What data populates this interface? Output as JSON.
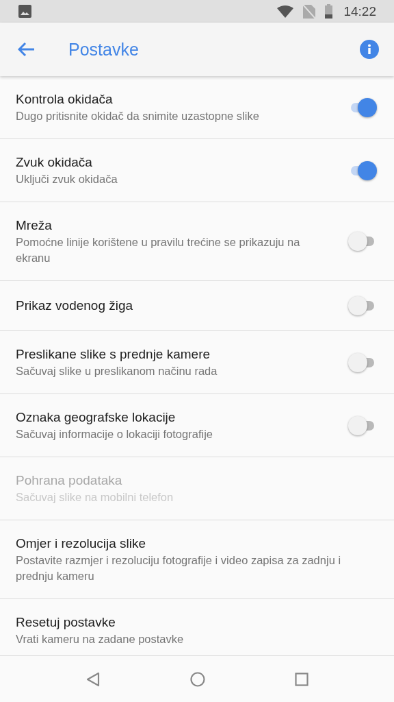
{
  "status_bar": {
    "time": "14:22"
  },
  "app_bar": {
    "title": "Postavke"
  },
  "settings": [
    {
      "kind": "switch",
      "title": "Kontrola okidača",
      "subtitle": "Dugo pritisnite okidač da snimite uzastopne slike",
      "on": true,
      "disabled": false
    },
    {
      "kind": "switch",
      "title": "Zvuk okidača",
      "subtitle": "Uključi zvuk okidača",
      "on": true,
      "disabled": false
    },
    {
      "kind": "switch",
      "title": "Mreža",
      "subtitle": "Pomoćne linije korištene u pravilu trećine se prikazuju na ekranu",
      "on": false,
      "disabled": false
    },
    {
      "kind": "switch",
      "title": "Prikaz vodenog žiga",
      "on": false,
      "disabled": false
    },
    {
      "kind": "switch",
      "title": "Preslikane slike s prednje kamere",
      "subtitle": "Sačuvaj slike u preslikanom načinu rada",
      "on": false,
      "disabled": false
    },
    {
      "kind": "switch",
      "title": "Oznaka geografske lokacije",
      "subtitle": "Sačuvaj informacije o lokaciji fotografije",
      "on": false,
      "disabled": false
    },
    {
      "kind": "plain",
      "title": "Pohrana podataka",
      "subtitle": "Sačuvaj slike na mobilni telefon",
      "disabled": true
    },
    {
      "kind": "plain",
      "title": "Omjer i rezolucija slike",
      "subtitle": "Postavite razmjer i rezoluciju fotografije i video zapisa za zadnju i prednju kameru",
      "disabled": false
    },
    {
      "kind": "plain",
      "title": "Resetuj postavke",
      "subtitle": "Vrati kameru na zadane postavke",
      "disabled": false
    }
  ]
}
